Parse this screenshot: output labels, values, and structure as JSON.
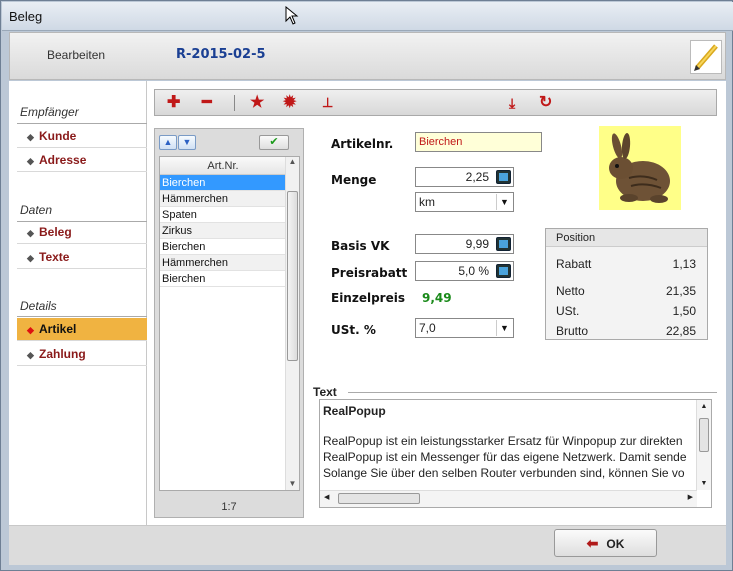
{
  "window": {
    "title": "Beleg"
  },
  "header": {
    "label": "Bearbeiten",
    "doc_number": "R-2015-02-5"
  },
  "sidebar": {
    "sections": [
      {
        "title": "Empfänger",
        "items": [
          "Kunde",
          "Adresse"
        ]
      },
      {
        "title": "Daten",
        "items": [
          "Beleg",
          "Texte"
        ]
      },
      {
        "title": "Details",
        "items": [
          "Artikel",
          "Zahlung"
        ]
      }
    ],
    "active": "Artikel"
  },
  "toolbar": {
    "icons": [
      "plus-icon",
      "minus-icon",
      "star-icon",
      "gear-icon",
      "tree-icon",
      "download-icon",
      "refresh-icon"
    ]
  },
  "list": {
    "column": "Art.Nr.",
    "rows": [
      "Bierchen",
      "Hämmerchen",
      "Spaten",
      "Zirkus",
      "Bierchen",
      "Hämmerchen",
      "Bierchen"
    ],
    "selected_index": 0,
    "counter": "1:7"
  },
  "form": {
    "artikelnr_label": "Artikelnr.",
    "artikelnr_value": "Bierchen",
    "menge_label": "Menge",
    "menge_value": "2,25",
    "unit_value": "km",
    "basis_label": "Basis VK",
    "basis_value": "9,99",
    "rabatt_label": "Preisrabatt",
    "rabatt_value": "5,0 %",
    "einzel_label": "Einzelpreis",
    "einzel_value": "9,49",
    "ust_label": "USt. %",
    "ust_value": "7,0"
  },
  "position": {
    "title": "Position",
    "rows": [
      {
        "label": "Rabatt",
        "value": "1,13"
      },
      {
        "label": "Netto",
        "value": "21,35"
      },
      {
        "label": "USt.",
        "value": "1,50"
      },
      {
        "label": "Brutto",
        "value": "22,85"
      }
    ]
  },
  "text": {
    "group_label": "Text",
    "heading": "RealPopup",
    "lines": [
      "RealPopup ist ein leistungsstarker Ersatz für Winpopup zur direkten",
      "RealPopup ist ein Messenger für das eigene Netzwerk. Damit sende",
      "Solange Sie über den selben Router verbunden sind, können Sie vo"
    ]
  },
  "ok_label": "OK",
  "colors": {
    "accent": "#f0b341",
    "doc_blue": "#1a3f93",
    "item_red": "#8a1a1a",
    "green": "#1a8a1a"
  }
}
